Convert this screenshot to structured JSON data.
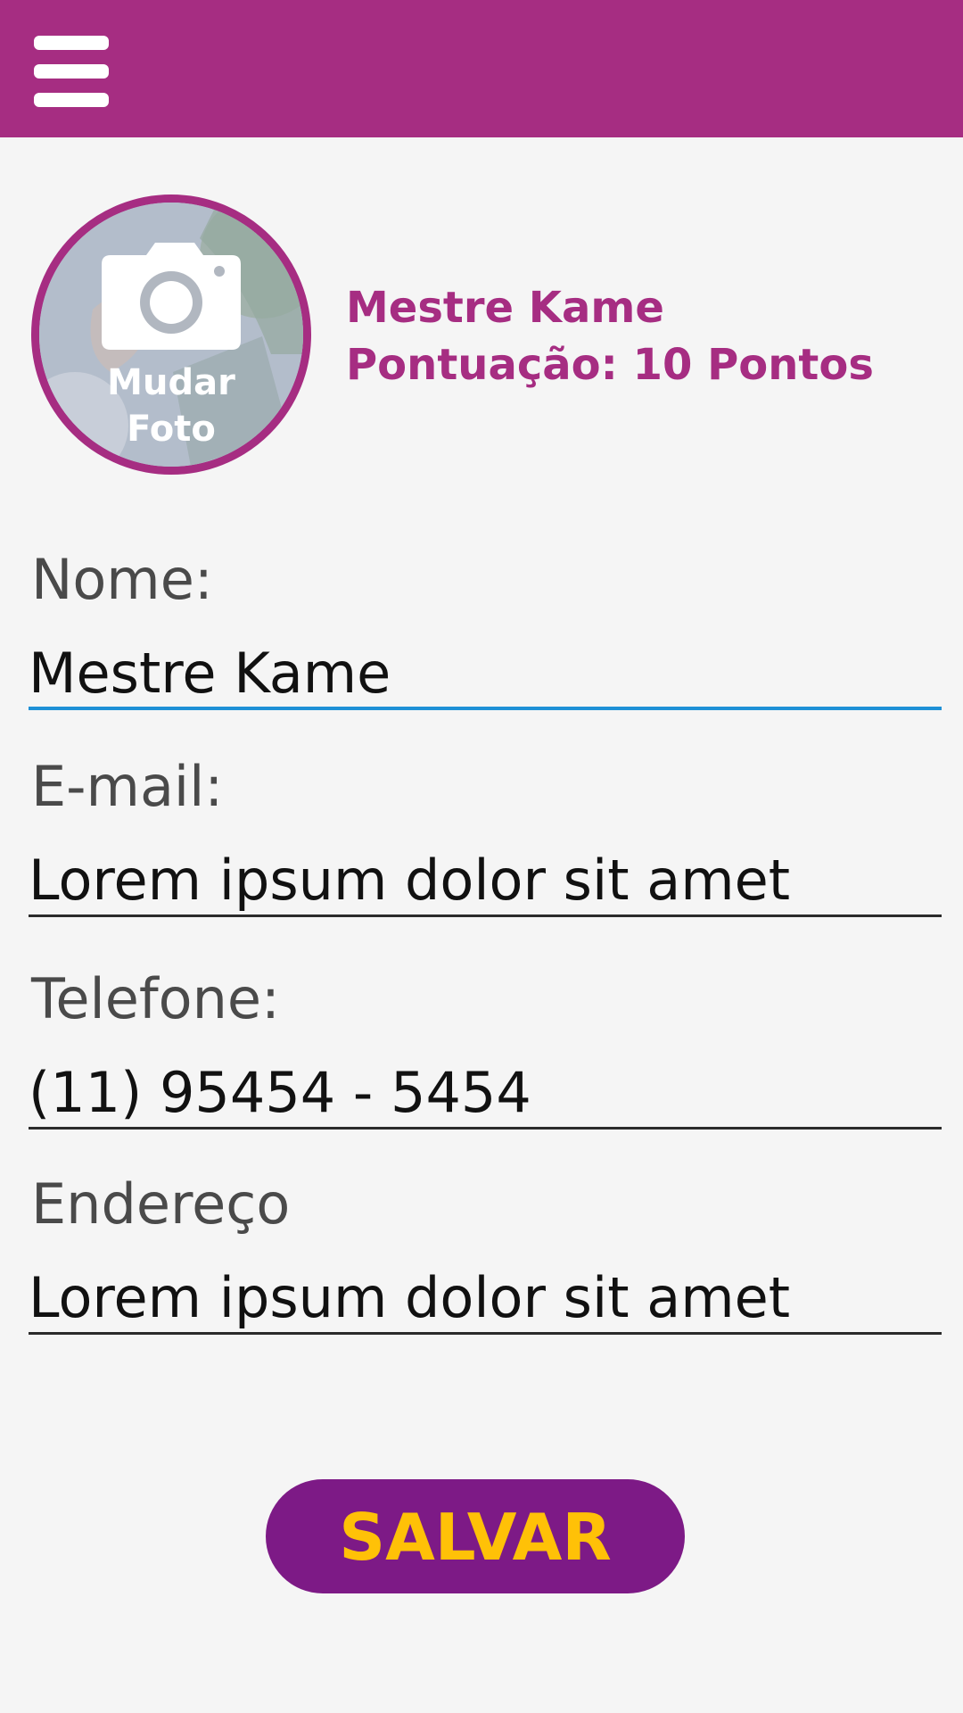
{
  "colors": {
    "accent": "#a62d82",
    "button_bg": "#7d1a86",
    "button_text": "#ffc107",
    "focus_line": "#1e90d6",
    "background": "#f5f5f5"
  },
  "header": {
    "menu_icon": "hamburger-menu-icon"
  },
  "profile": {
    "photo_icon": "camera-icon",
    "change_photo_label": "Mudar\nFoto",
    "name": "Mestre Kame",
    "score": "Pontuação: 10 Pontos"
  },
  "form": {
    "name_label": "Nome:",
    "name_value": "Mestre Kame",
    "email_label": "E-mail:",
    "email_value": "Lorem ipsum dolor sit amet",
    "phone_label": "Telefone:",
    "phone_value": "(11) 95454 - 5454",
    "address_label": "Endereço",
    "address_value": "Lorem ipsum dolor sit amet"
  },
  "actions": {
    "save_label": "SALVAR"
  }
}
